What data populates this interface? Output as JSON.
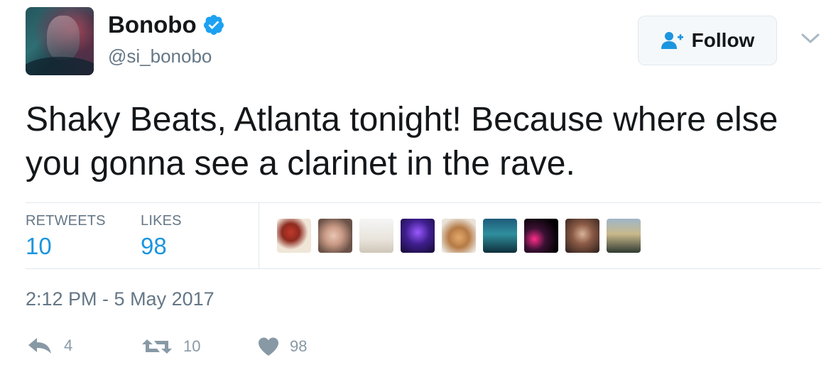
{
  "user": {
    "display_name": "Bonobo",
    "handle": "@si_bonobo",
    "verified_icon": "verified-badge-icon"
  },
  "follow_button": {
    "label": "Follow",
    "icon": "add-user-icon"
  },
  "menu_icon": "chevron-down-icon",
  "tweet": {
    "text": "Shaky Beats, Atlanta tonight! Because where else you gonna see a clarinet in the rave."
  },
  "stats": {
    "retweets_label": "RETWEETS",
    "retweets_value": "10",
    "likes_label": "LIKES",
    "likes_value": "98"
  },
  "timestamp": "2:12 PM - 5 May 2017",
  "actions": {
    "reply_count": "4",
    "retweet_count": "10",
    "like_count": "98"
  },
  "colors": {
    "accent": "#1b95e0",
    "muted": "#657786",
    "action_gray": "#8899a6",
    "divider": "#e1e8ed"
  }
}
